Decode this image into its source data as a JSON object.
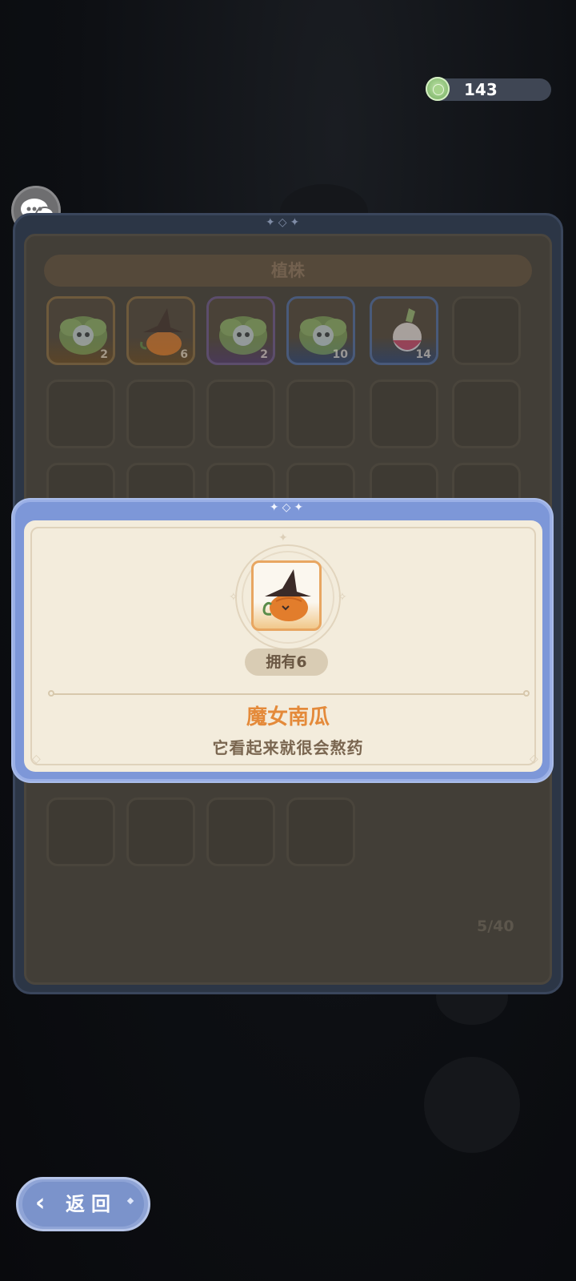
{
  "header": {
    "coin_count": "143"
  },
  "inventory": {
    "title": "植株",
    "capacity": "5/40",
    "items": [
      {
        "icon": "lettuce-creature-icon",
        "count": "2",
        "rarity": "orange"
      },
      {
        "icon": "witch-pumpkin-icon",
        "count": "6",
        "rarity": "orange"
      },
      {
        "icon": "lettuce-creature-icon",
        "count": "2",
        "rarity": "purple"
      },
      {
        "icon": "lettuce-creature-icon",
        "count": "10",
        "rarity": "blue"
      },
      {
        "icon": "radish-icon",
        "count": "14",
        "rarity": "blue"
      }
    ]
  },
  "detail": {
    "owned": "拥有6",
    "name": "魔女南瓜",
    "description": "它看起来就很会熬药",
    "icon": "witch-pumpkin-icon"
  },
  "back_button": {
    "label": "返回"
  },
  "colors": {
    "accent_orange": "#e48a3a",
    "popup_blue": "#7d97d8",
    "card_cream": "#f3ecdc"
  }
}
